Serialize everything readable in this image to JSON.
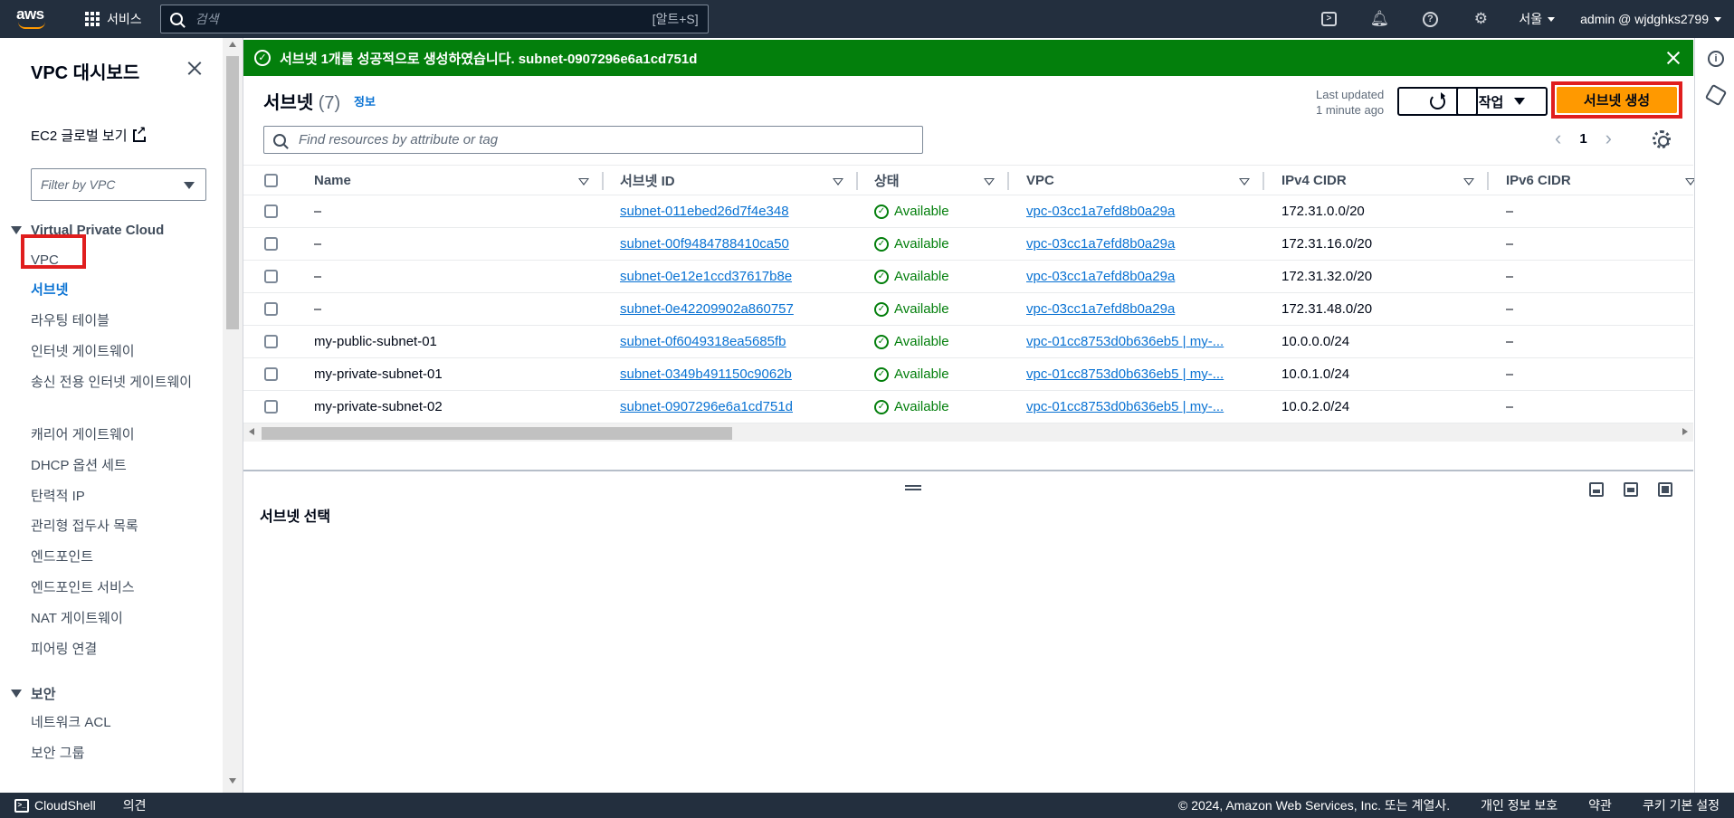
{
  "topnav": {
    "logo": "aws",
    "services_label": "서비스",
    "search_placeholder": "검색",
    "search_shortcut": "[알트+S]",
    "region": "서울",
    "account": "admin @ wjdghks2799",
    "icons": [
      "cloudshell-icon",
      "bell-icon",
      "help-icon",
      "settings-icon"
    ]
  },
  "sidebar": {
    "title": "VPC 대시보드",
    "ec2_link": "EC2 글로벌 보기",
    "filter_placeholder": "Filter by VPC",
    "section_vpc": "Virtual Private Cloud",
    "vpc_items": [
      "VPC",
      "서브넷",
      "라우팅 테이블",
      "인터넷 게이트웨이",
      "송신 전용 인터넷 게이트웨이",
      "캐리어 게이트웨이",
      "DHCP 옵션 세트",
      "탄력적 IP",
      "관리형 접두사 목록",
      "엔드포인트",
      "엔드포인트 서비스",
      "NAT 게이트웨이",
      "피어링 연결"
    ],
    "section_security": "보안",
    "security_items": [
      "네트워크 ACL",
      "보안 그룹"
    ]
  },
  "flash": {
    "message": "서브넷 1개를 성공적으로 생성하였습니다. subnet-0907296e6a1cd751d",
    "color": "#037f0c"
  },
  "header": {
    "title": "서브넷",
    "count": "(7)",
    "info": "정보",
    "last_updated_1": "Last updated",
    "last_updated_2": "1 minute ago",
    "actions_label": "작업",
    "create_label": "서브넷 생성",
    "create_color": "#ff9900"
  },
  "filter": {
    "placeholder": "Find resources by attribute or tag",
    "page": "1"
  },
  "table": {
    "columns": [
      "Name",
      "서브넷 ID",
      "상태",
      "VPC",
      "IPv4 CIDR",
      "IPv6 CIDR"
    ],
    "rows": [
      {
        "name": "–",
        "subnet_id": "subnet-011ebed26d7f4e348",
        "state": "Available",
        "vpc": "vpc-03cc1a7efd8b0a29a",
        "ipv4": "172.31.0.0/20",
        "ipv6": "–"
      },
      {
        "name": "–",
        "subnet_id": "subnet-00f9484788410ca50",
        "state": "Available",
        "vpc": "vpc-03cc1a7efd8b0a29a",
        "ipv4": "172.31.16.0/20",
        "ipv6": "–"
      },
      {
        "name": "–",
        "subnet_id": "subnet-0e12e1ccd37617b8e",
        "state": "Available",
        "vpc": "vpc-03cc1a7efd8b0a29a",
        "ipv4": "172.31.32.0/20",
        "ipv6": "–"
      },
      {
        "name": "–",
        "subnet_id": "subnet-0e42209902a860757",
        "state": "Available",
        "vpc": "vpc-03cc1a7efd8b0a29a",
        "ipv4": "172.31.48.0/20",
        "ipv6": "–"
      },
      {
        "name": "my-public-subnet-01",
        "subnet_id": "subnet-0f6049318ea5685fb",
        "state": "Available",
        "vpc": "vpc-01cc8753d0b636eb5 | my-...",
        "ipv4": "10.0.0.0/24",
        "ipv6": "–"
      },
      {
        "name": "my-private-subnet-01",
        "subnet_id": "subnet-0349b491150c9062b",
        "state": "Available",
        "vpc": "vpc-01cc8753d0b636eb5 | my-...",
        "ipv4": "10.0.1.0/24",
        "ipv6": "–"
      },
      {
        "name": "my-private-subnet-02",
        "subnet_id": "subnet-0907296e6a1cd751d",
        "state": "Available",
        "vpc": "vpc-01cc8753d0b636eb5 | my-...",
        "ipv4": "10.0.2.0/24",
        "ipv6": "–"
      }
    ]
  },
  "split": {
    "title": "서브넷 선택"
  },
  "footer": {
    "cloudshell": "CloudShell",
    "feedback": "의견",
    "copyright": "© 2024, Amazon Web Services, Inc. 또는 계열사.",
    "privacy": "개인 정보 보호",
    "terms": "약관",
    "cookies": "쿠키 기본 설정"
  }
}
